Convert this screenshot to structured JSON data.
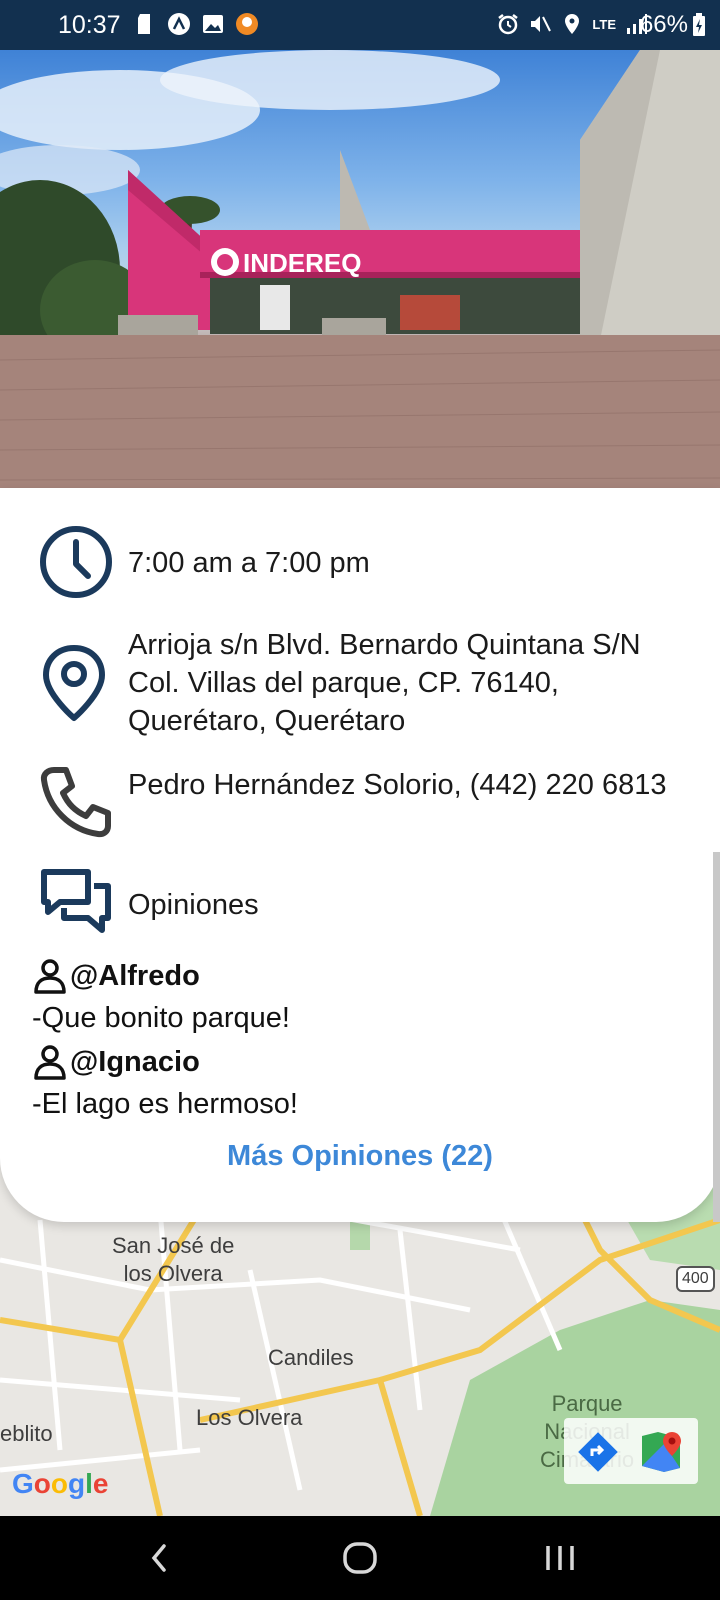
{
  "status_bar": {
    "time": "10:37",
    "network": "LTE",
    "battery": "66%"
  },
  "hero": {
    "sign_text": "INDEREQ"
  },
  "info": {
    "hours": "7:00 am a 7:00 pm",
    "address": "Arrioja s/n Blvd. Bernardo Quintana S/N Col. Villas del parque, CP. 76140, Querétaro, Querétaro",
    "phone": "Pedro Hernández Solorio, (442) 220 6813",
    "reviews_heading": "Opiniones"
  },
  "reviews": [
    {
      "user": "@Alfredo",
      "text": "-Que bonito parque!"
    },
    {
      "user": "@Ignacio",
      "text": "-El lago es hermoso!"
    }
  ],
  "more_reviews_label": "Más Opiniones (22)",
  "map": {
    "labels": {
      "san_jose": "San José de\nlos Olvera",
      "candiles": "Candiles",
      "los_olvera": "Los Olvera",
      "pueblito": "eblito",
      "parque": "Parque\nNacional\nCimatario",
      "route_400": "400"
    },
    "attribution": "Google"
  },
  "colors": {
    "status_bar": "#12304f",
    "icon_primary": "#1b3a5c",
    "link": "#3d88d8",
    "sign_pink": "#d8357a"
  }
}
